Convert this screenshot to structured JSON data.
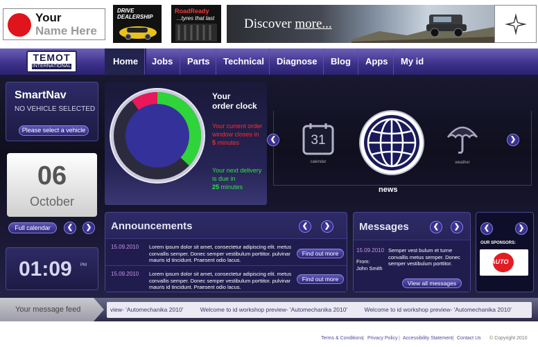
{
  "brand": {
    "your": "Your",
    "name": "Name Here"
  },
  "ads": {
    "ad1_line1": "DRIVE",
    "ad1_line2": "DEALERSHIP",
    "ad2_line1": "RoadReady",
    "ad2_line2": "...tyres that last",
    "ad3_text": "Discover ",
    "ad3_more": "more..."
  },
  "nav": {
    "logo_main": "TEMOT",
    "logo_sub": "INTERNATIONAL",
    "items": [
      "Home",
      "Jobs",
      "Parts",
      "Technical",
      "Diagnose",
      "Blog",
      "Apps",
      "My id"
    ]
  },
  "smartnav": {
    "title": "SmartNav",
    "subtitle": "NO VEHICLE SELECTED",
    "button": "Please select a vehicle"
  },
  "date": {
    "day": "06",
    "month": "October",
    "calendar_button": "Full calendar"
  },
  "time": {
    "display": "01:09",
    "ampm": "PM"
  },
  "order_clock": {
    "title_line1": "Your",
    "title_line2": "order clock",
    "closes_text": "Your current order window closes in",
    "closes_value": "5",
    "closes_unit": "minutes",
    "delivery_text": "Your next delivery is due in",
    "delivery_value": "25",
    "delivery_unit": "minutes",
    "green_fraction": 0.25,
    "red_fraction": 0.1
  },
  "carousel": {
    "calendar_day": "31",
    "calendar_caption": "calendar",
    "weather_caption": "weather",
    "news_label": "news"
  },
  "announcements": {
    "title": "Announcements",
    "items": [
      {
        "date": "15.09.2010",
        "text": "Lorem ipsum dolor sit amet, consectetur adipiscing elit. metus convallis semper. Donec semper vestibulum porttitor. pulvinar mauris id tincidunt. Praesent odio lacus.",
        "button": "Find out more"
      },
      {
        "date": "15.09.2010",
        "text": "Lorem ipsum dolor sit amet, consectetur adipiscing elit. metus convallis semper. Donec semper vestibulum porttitor. pulvinar mauris id tincidunt. Praesent odio lacus.",
        "button": "Find out more"
      }
    ]
  },
  "messages": {
    "title": "Messages",
    "date": "15.09.2010",
    "from_label": "From:",
    "from_name": "John Smith",
    "text": "Semper vest bulum et turne convallis metus semper. Donec semper vestibulum porttitor.",
    "button": "View all messages"
  },
  "sponsors": {
    "label": "OUR SPONSORS:",
    "logo_text": "AUTO"
  },
  "feed": {
    "label": "Your message feed",
    "items": [
      "view- 'Automechanika 2010'",
      "Welcome to id workshop preview- 'Automechanika 2010'",
      "Welcome to id workshop preview- 'Automechanika 2010'"
    ]
  },
  "footer": {
    "links": [
      "Terms & Conditions",
      "Privacy Policy",
      "Accessibility Statement",
      "Contact Us"
    ],
    "copyright": "© Copyright 2010"
  }
}
